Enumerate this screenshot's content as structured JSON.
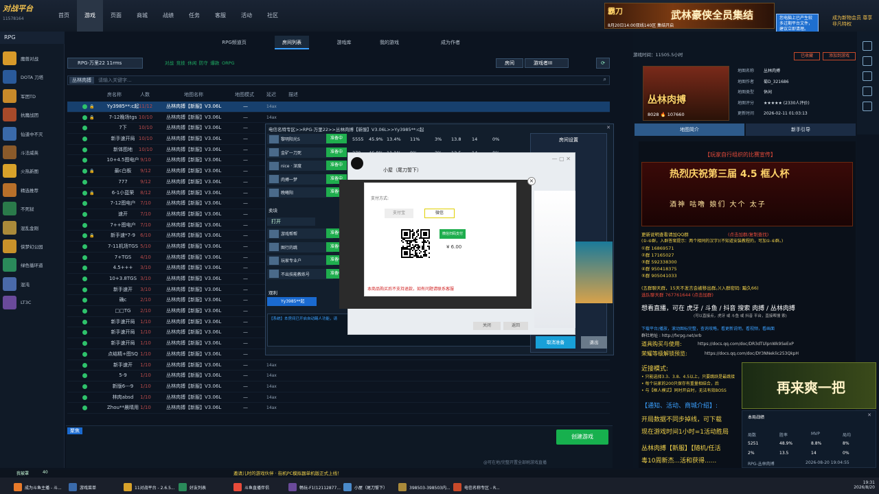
{
  "topnav": {
    "logo_title": "对战平台",
    "user_id": "11578164",
    "items": [
      "首页",
      "游戏",
      "页面",
      "商城",
      "战绩",
      "任务",
      "客服",
      "活动",
      "社区"
    ],
    "active_index": 1,
    "banner_logo": "霸刀",
    "banner_text": "武林豪侠全员集结",
    "banner_sub": "8月20日14:00双线140区 集结开启",
    "tip_text": "您电脑上已产生较多过期平台文件，建议立即清理。",
    "vip_text": "成为新物会员 尊享非凡特权"
  },
  "sidebar": {
    "header": "RPG",
    "items": [
      {
        "label": "魔兽对战",
        "color": "#d89a2a"
      },
      {
        "label": "DOTA 刀塔",
        "color": "#2a5a9a"
      },
      {
        "label": "军团TD",
        "color": "#c88a2a"
      },
      {
        "label": "抗魔战团",
        "color": "#a84a2a"
      },
      {
        "label": "仙道中不灭",
        "color": "#3a6aaa"
      },
      {
        "label": "斗法威英",
        "color": "#8a5a2a"
      },
      {
        "label": "火热新图",
        "color": "#d8a22a"
      },
      {
        "label": "精选推荐",
        "color": "#b8702a"
      },
      {
        "label": "不死狱",
        "color": "#2a7a4a"
      },
      {
        "label": "混乱金刚",
        "color": "#aa8a3a"
      },
      {
        "label": "侠梦幻公园",
        "color": "#c8922a"
      },
      {
        "label": "绿色循环道",
        "color": "#2a8a5a"
      },
      {
        "label": "混沌",
        "color": "#4a6aaa"
      },
      {
        "label": "LT3C",
        "color": "#6a4a9a"
      }
    ]
  },
  "tabs": [
    "RPG频道页",
    "房间列表",
    "游戏库",
    "我的游戏",
    "成为作者"
  ],
  "tabs_active": 1,
  "filter": {
    "game": "RPG-万里22 11rms",
    "options": [
      "对战",
      "竞技",
      "休闲",
      "防守",
      "爆款",
      "ORPG"
    ],
    "room_btn1": "房间",
    "room_btn2": "游戏者III"
  },
  "search": {
    "tag": "丛林肉搏",
    "placeholder": "请输入关键字..."
  },
  "table": {
    "headers": [
      "房名称",
      "人数",
      "地图名称",
      "地图模式",
      "延迟",
      "描述"
    ],
    "rows": [
      {
        "name": "Yy3985**:c起",
        "num": "11/12",
        "map": "丛林肉搏【新服】V3.06L",
        "mode": "—",
        "delay": "14ax",
        "lock": true,
        "sel": true
      },
      {
        "name": "7-12晚场tgs",
        "num": "10/10",
        "map": "丛林肉搏【新服】V3.06L",
        "mode": "—",
        "delay": "14ax",
        "lock": true,
        "sel": false
      },
      {
        "name": "7下",
        "num": "10/10",
        "map": "丛林肉搏【新服】V3.06L",
        "mode": "—",
        "delay": "14ax",
        "lock": false,
        "sel": false
      },
      {
        "name": "新手速开局",
        "num": "10/10",
        "map": "丛林肉搏【新服】V3.06L",
        "mode": "—",
        "delay": "14ax",
        "lock": false,
        "sel": false
      },
      {
        "name": "新体图地",
        "num": "10/10",
        "map": "丛林肉搏【新服】V3.06L",
        "mode": "—",
        "delay": "14ax",
        "lock": false,
        "sel": false
      },
      {
        "name": "10+4.5图电户",
        "num": "9/10",
        "map": "丛林肉搏【新服】V3.06L",
        "mode": "—",
        "delay": "14ax",
        "lock": false,
        "sel": false
      },
      {
        "name": "最c白板",
        "num": "9/12",
        "map": "丛林肉搏【新服】V3.06L",
        "mode": "—",
        "delay": "14ax",
        "lock": true,
        "sel": false
      },
      {
        "name": "777",
        "num": "9/12",
        "map": "丛林肉搏【新服】V3.06L",
        "mode": "—",
        "delay": "14ax",
        "lock": false,
        "sel": false
      },
      {
        "name": "6-1小蓝荣",
        "num": "8/12",
        "map": "丛林肉搏【新服】V3.06L",
        "mode": "—",
        "delay": "14ax",
        "lock": true,
        "sel": false
      },
      {
        "name": "7-12图电户",
        "num": "7/10",
        "map": "丛林肉搏【新服】V3.06L",
        "mode": "—",
        "delay": "14ax",
        "lock": false,
        "sel": false
      },
      {
        "name": "速开",
        "num": "7/10",
        "map": "丛林肉搏【新服】V3.06L",
        "mode": "—",
        "delay": "14ax",
        "lock": false,
        "sel": false
      },
      {
        "name": "7++图电户",
        "num": "7/10",
        "map": "丛林肉搏【新服】V3.06L",
        "mode": "—",
        "delay": "14ax",
        "lock": false,
        "sel": false
      },
      {
        "name": "新手速*7-9",
        "num": "6/10",
        "map": "丛林肉搏【新服】V3.06L",
        "mode": "—",
        "delay": "14ax",
        "lock": true,
        "sel": false
      },
      {
        "name": "7-11机场TGS",
        "num": "5/10",
        "map": "丛林肉搏【新服】V3.06L",
        "mode": "—",
        "delay": "14ax",
        "lock": false,
        "sel": false
      },
      {
        "name": "7+TGS",
        "num": "4/10",
        "map": "丛林肉搏【新服】V3.06L",
        "mode": "—",
        "delay": "14ax",
        "lock": false,
        "sel": false
      },
      {
        "name": "4.5+++",
        "num": "3/10",
        "map": "丛林肉搏【新服】V3.06L",
        "mode": "—",
        "delay": "14ax",
        "lock": false,
        "sel": false
      },
      {
        "name": "10+3.8TGS",
        "num": "3/10",
        "map": "丛林肉搏【新服】V3.06L",
        "mode": "—",
        "delay": "14ax",
        "lock": false,
        "sel": false
      },
      {
        "name": "新手速开",
        "num": "3/10",
        "map": "丛林肉搏【新服】V3.06L",
        "mode": "—",
        "delay": "14ax",
        "lock": false,
        "sel": false
      },
      {
        "name": "确c",
        "num": "2/10",
        "map": "丛林肉搏【新服】V3.06L",
        "mode": "—",
        "delay": "14ax",
        "lock": false,
        "sel": false
      },
      {
        "name": "□□TG",
        "num": "2/10",
        "map": "丛林肉搏【新服】V3.06L",
        "mode": "—",
        "delay": "14ax",
        "lock": false,
        "sel": false
      },
      {
        "name": "新手速开局",
        "num": "1/10",
        "map": "丛林肉搏【新服】V3.06L",
        "mode": "—",
        "delay": "14ax",
        "lock": false,
        "sel": false
      },
      {
        "name": "新手速开局",
        "num": "1/10",
        "map": "丛林肉搏【新服】V3.06L",
        "mode": "—",
        "delay": "14ax",
        "lock": false,
        "sel": false
      },
      {
        "name": "新手速开局",
        "num": "1/10",
        "map": "丛林肉搏【新服】V3.06L",
        "mode": "—",
        "delay": "14ax",
        "lock": false,
        "sel": false
      },
      {
        "name": "点结精+图SQ",
        "num": "1/10",
        "map": "丛林肉搏【新服】V3.06L",
        "mode": "—",
        "delay": "14ax",
        "lock": false,
        "sel": false
      },
      {
        "name": "新手速开",
        "num": "1/10",
        "map": "丛林肉搏【新服】V3.06L",
        "mode": "—",
        "delay": "14ax",
        "lock": false,
        "sel": false
      },
      {
        "name": "5-9",
        "num": "1/10",
        "map": "丛林肉搏【新服】V3.06L",
        "mode": "—",
        "delay": "14ax",
        "lock": false,
        "sel": false
      },
      {
        "name": "新版6---9",
        "num": "1/10",
        "map": "丛林肉搏【新服】V3.06L",
        "mode": "—",
        "delay": "14ax",
        "lock": false,
        "sel": false
      },
      {
        "name": "林肉absd",
        "num": "1/10",
        "map": "丛林肉搏【新服】V3.06L",
        "mode": "—",
        "delay": "14ax",
        "lock": false,
        "sel": false
      },
      {
        "name": "Zhou**晨晴用",
        "num": "1/10",
        "map": "丛林肉搏【新服】V3.06L",
        "mode": "—",
        "delay": "14ax",
        "lock": false,
        "sel": false
      }
    ],
    "footer_label": "聚焦",
    "start_button": "创建游戏",
    "footer_note": "@可在地/完整开置全部刷游戏直播"
  },
  "room": {
    "title": "电信名特专区>>RPG-万里22>>丛林肉搏【新服】V3.06L>>Yy3985**:c起",
    "players": [
      "黎明阳光S",
      "金矿一刀死",
      "nice · 深度",
      "肉搏一梦",
      "晚曦阳"
    ],
    "badge": "准备中",
    "stats": [
      "5555",
      "45.9%",
      "13.4%",
      "11%",
      "3%",
      "13.8",
      "14",
      "0%"
    ],
    "stats2": [
      "370",
      "46.8%",
      "11.1%",
      "9%",
      "3%",
      "13.5",
      "14",
      "0%"
    ],
    "group2_label": "卖块",
    "group2_players": [
      "游戏帮帮",
      "图行的跳",
      "玩家专业户",
      "不出技能教练号"
    ],
    "group3_label": "观利",
    "group3_player": "Yy3985**起",
    "chat_msg": "【系统】本房间已开启自动踢人功能，请",
    "settings_title": "房间设置",
    "cancel_btn": "取消准备",
    "exit_btn": "退出"
  },
  "payment": {
    "window_title": "小屋（尾刀誓下）",
    "mode_label": "支付方式:",
    "opt1": "支付宝",
    "opt2": "微信",
    "wechat_label": "微信扫码支付",
    "price": "¥ 6.00",
    "note": "本商品购买后不支持退款，如有问题请联系客服",
    "close_btn": "关闭",
    "confirm_btn": "返回"
  },
  "right": {
    "play_time": "游戏时间：11505.5小时",
    "btn_a": "已收藏",
    "btn_b": "添加到游戏",
    "cover_title": "丛林肉搏",
    "cover_count": "8028 🔥 107660",
    "info": [
      {
        "k": "地图名称",
        "v": "丛林肉搏"
      },
      {
        "k": "地图作者",
        "v": "菊D_321686"
      },
      {
        "k": "地图类型",
        "v": "休闲"
      },
      {
        "k": "地图评分",
        "v": "★★★★★ (2330人评价)"
      },
      {
        "k": "更新时间",
        "v": "2026-02-11 01:03:13"
      }
    ],
    "tabs": [
      "地图简介",
      "新手引导"
    ],
    "tabs_active": 0,
    "promo_title": "【玩家自行组织的比赛宣传】",
    "event_title": "热烈庆祝第三届 4.5 框人杯",
    "event_names": "酒神  咕噜  娘们  大个  太子",
    "qq_title": "更新说明查看请加QQ群",
    "qq_line": "(点击加群/复制查找)",
    "qq_desc": "(①-⑥群，入群答案提示：两个相同的汉字)(不知道安装教程的，可加①-⑥群。)",
    "groups": [
      "①群 16869571",
      "②群 17165027",
      "③群 592338300",
      "④群 950418375",
      "⑤群 905041033"
    ],
    "yy_line": "(五群聊天群，15天不发言会被移出群。)(入群密码: 黯久66)",
    "yy2": "选队聊天群 767761644 (点击加群)",
    "live_line": "想看直播，可在 虎牙 / 斗鱼 / 抖音 搜索 肉搏 / 丛林肉搏",
    "live_sub": "(可以直接点，虎牙 或 斗鱼 或 抖音 平台，直接帮搜 索)",
    "dl_line": "下载平台/播放，滚动图标完整，查询攻略，看更新说明，看视频，看画面",
    "addr": "群社地址 : http://fxrpg.net/xrb",
    "shop_line": "道具购买与使用:",
    "shop_url": "https://docs.qq.com/doc/DR3dTUlpnWk9SeExP",
    "rank_line": "荣耀等级解锁预览:",
    "rank_url": "https://docs.qq.com/doc/DY3NNeklic253QkpH",
    "mode_title": "近接模式:",
    "mode1": "• 只能选择3.3、3.8、4.5以上，只要跳跃是最跳接",
    "mode2": "• 每个玩家的200只保存有重量相结合，后",
    "mode3": "• 与【框人模式】同时开启时，无法有效BOSS",
    "notice_title": "【通知、活动、商城介绍】:",
    "notice1": "开局数据不同步掉线，可下载",
    "notice2": "现在游戏时间1小时=1活动胜局",
    "notice3": "丛林肉搏【新服】【随机/任活",
    "notice4": "毒10周新杰...活和获得......"
  },
  "replay_text": "再来爽一把",
  "recent": {
    "title": "本局战绩",
    "row1": [
      "胜利",
      "",
      ""
    ],
    "labels": [
      "局数",
      "胜率",
      "MVP",
      "局均"
    ],
    "vals": [
      "5251",
      "48.9%",
      "8.8%",
      "8%"
    ],
    "vals2": [
      "2%",
      "13.5",
      "14",
      "0%"
    ],
    "footer": "RPG-丛林肉搏",
    "footer_time": "2026-08-20 19:04:55"
  },
  "ticker": "邀请儿时的游戏伙伴 · 街机PC模拟器单机版正式上线！",
  "taskbar": {
    "items": [
      "成为斗鱼主播 - 斗...",
      "游戏菜单",
      "11对战平台 - 2.6.5...",
      "好友列表",
      "斗鱼直播伴侣",
      "畅玩-F1(12112877...",
      "小屋（尾刀誓下）",
      "398503-398503内...",
      "电信名称专区 - R..."
    ],
    "time": "19:31",
    "date": "2026/8/20",
    "left_text": "我被罩",
    "count": "40"
  }
}
